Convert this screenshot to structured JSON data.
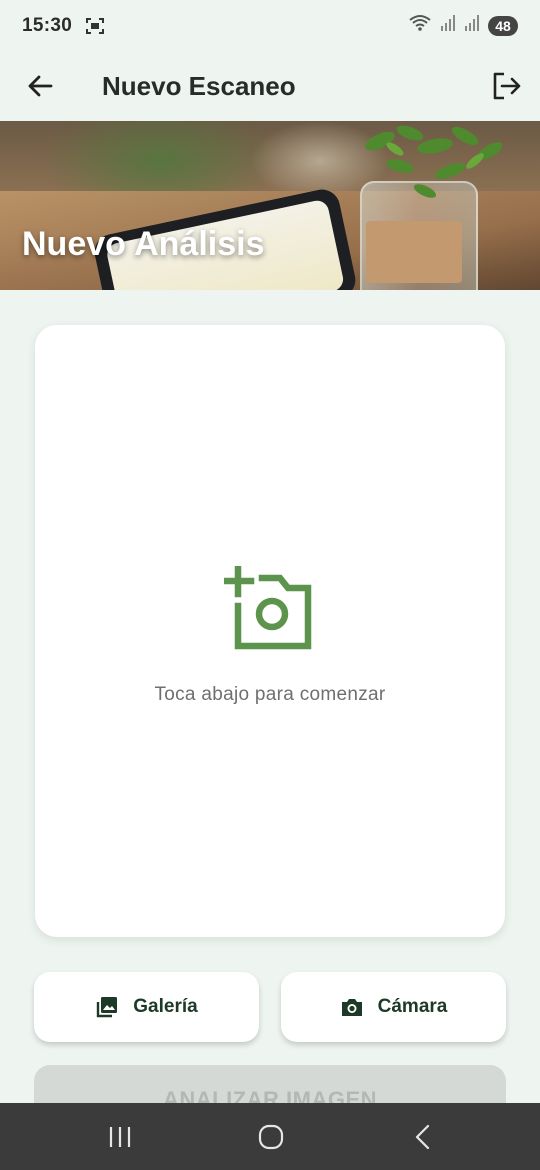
{
  "status_bar": {
    "time": "15:30",
    "battery": "48",
    "icons": [
      "screenshot-icon",
      "wifi-icon",
      "signal-icon",
      "signal-icon"
    ]
  },
  "app_bar": {
    "title": "Nuevo Escaneo",
    "back_icon": "arrow-left-icon",
    "logout_icon": "logout-icon"
  },
  "banner": {
    "title": "Nuevo Análisis"
  },
  "upload_card": {
    "icon": "add-photo-icon",
    "hint": "Toca abajo para comenzar"
  },
  "buttons": {
    "gallery_label": "Galería",
    "gallery_icon": "image-icon",
    "camera_label": "Cámara",
    "camera_icon": "camera-icon",
    "analyze_label": "ANALIZAR IMAGEN"
  },
  "nav_bar": {
    "items": [
      "recents-icon",
      "home-icon",
      "back-icon"
    ]
  },
  "colors": {
    "accent_green": "#5d944d",
    "dark_green": "#1d3a28",
    "background": "#eef5f1"
  }
}
